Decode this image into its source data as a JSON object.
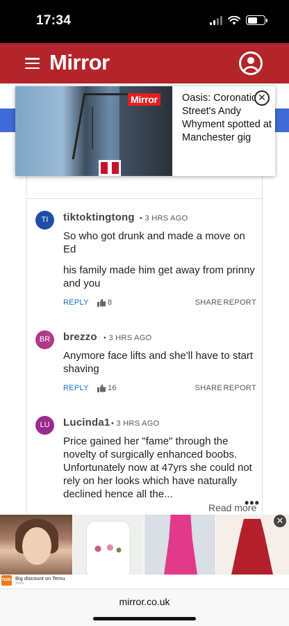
{
  "status_bar": {
    "time": "17:34"
  },
  "header": {
    "brand": "Mirror"
  },
  "video_popup": {
    "badge": "Mirror",
    "title": "Oasis: Coronation Street's Andy Whyment spotted at Manchester gig",
    "close_glyph": "✕"
  },
  "comments": [
    {
      "initials": "TI",
      "avatar_color": "#1e4fa8",
      "user": "tiktoktingtong",
      "time": "• 3 HRS AGO",
      "paragraphs": [
        "So who got drunk and made a move on Ed",
        "his family made him get away from prinny and you"
      ],
      "reply": "REPLY",
      "likes": "8",
      "share": "SHARE",
      "report": "REPORT"
    },
    {
      "initials": "BR",
      "avatar_color": "#b03a8a",
      "user": "brezzo",
      "time": "• 3 HRS AGO",
      "paragraphs": [
        "Anymore face lifts and she'll have to start shaving"
      ],
      "reply": "REPLY",
      "likes": "16",
      "share": "SHARE",
      "report": "REPORT"
    },
    {
      "initials": "LU",
      "avatar_color": "#9a2a8c",
      "user": "Lucinda1",
      "time": "• 3 HRS AGO",
      "paragraphs": [
        "Price gained her \"fame\" through the novelty of surgically enhanced boobs. Unfortunately now at 47yrs she could not rely on her looks which have naturally declined hence all the..."
      ]
    }
  ],
  "read_more": "Read more",
  "more_dots": "•••",
  "ad": {
    "text": "Big discount on Temu",
    "sub": "Temu",
    "logo": "TEMU",
    "close_glyph": "✕"
  },
  "url_bar": {
    "url": "mirror.co.uk"
  },
  "colors": {
    "header_bg": "#b3252a",
    "reply_link": "#1d6fc9",
    "side_tab": "#3f6ad8"
  },
  "icons": [
    "hamburger-icon",
    "account-icon",
    "close-icon",
    "thumbs-up-icon",
    "more-icon"
  ]
}
